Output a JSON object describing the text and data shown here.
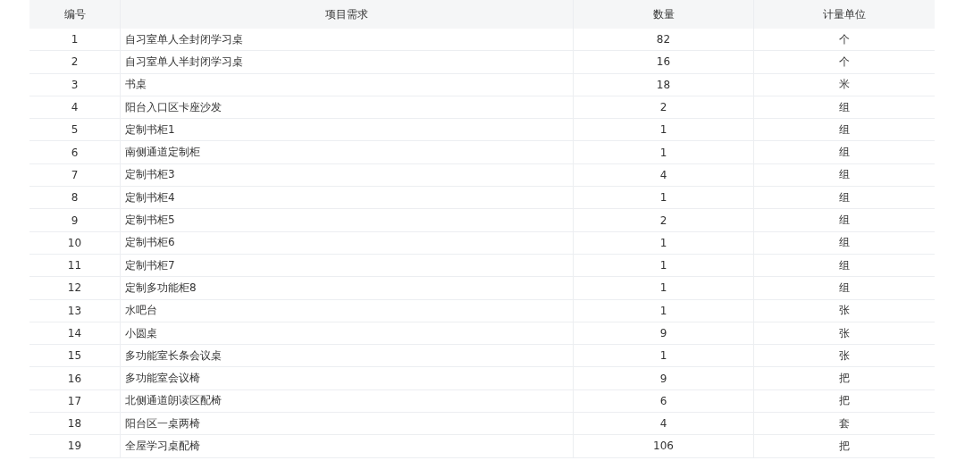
{
  "table": {
    "columns": [
      "编号",
      "项目需求",
      "数量",
      "计量单位"
    ],
    "rows": [
      [
        "1",
        "自习室单人全封闭学习桌",
        "82",
        "个"
      ],
      [
        "2",
        "自习室单人半封闭学习桌",
        "16",
        "个"
      ],
      [
        "3",
        "书桌",
        "18",
        "米"
      ],
      [
        "4",
        "阳台入口区卡座沙发",
        "2",
        "组"
      ],
      [
        "5",
        "定制书柜1",
        "1",
        "组"
      ],
      [
        "6",
        "南侧通道定制柜",
        "1",
        "组"
      ],
      [
        "7",
        "定制书柜3",
        "4",
        "组"
      ],
      [
        "8",
        "定制书柜4",
        "1",
        "组"
      ],
      [
        "9",
        "定制书柜5",
        "2",
        "组"
      ],
      [
        "10",
        "定制书柜6",
        "1",
        "组"
      ],
      [
        "11",
        "定制书柜7",
        "1",
        "组"
      ],
      [
        "12",
        "定制多功能柜8",
        "1",
        "组"
      ],
      [
        "13",
        "水吧台",
        "1",
        "张"
      ],
      [
        "14",
        "小圆桌",
        "9",
        "张"
      ],
      [
        "15",
        "多功能室长条会议桌",
        "1",
        "张"
      ],
      [
        "16",
        "多功能室会议椅",
        "9",
        "把"
      ],
      [
        "17",
        "北侧通道朗读区配椅",
        "6",
        "把"
      ],
      [
        "18",
        "阳台区一桌两椅",
        "4",
        "套"
      ],
      [
        "19",
        "全屋学习桌配椅",
        "106",
        "把"
      ]
    ]
  }
}
